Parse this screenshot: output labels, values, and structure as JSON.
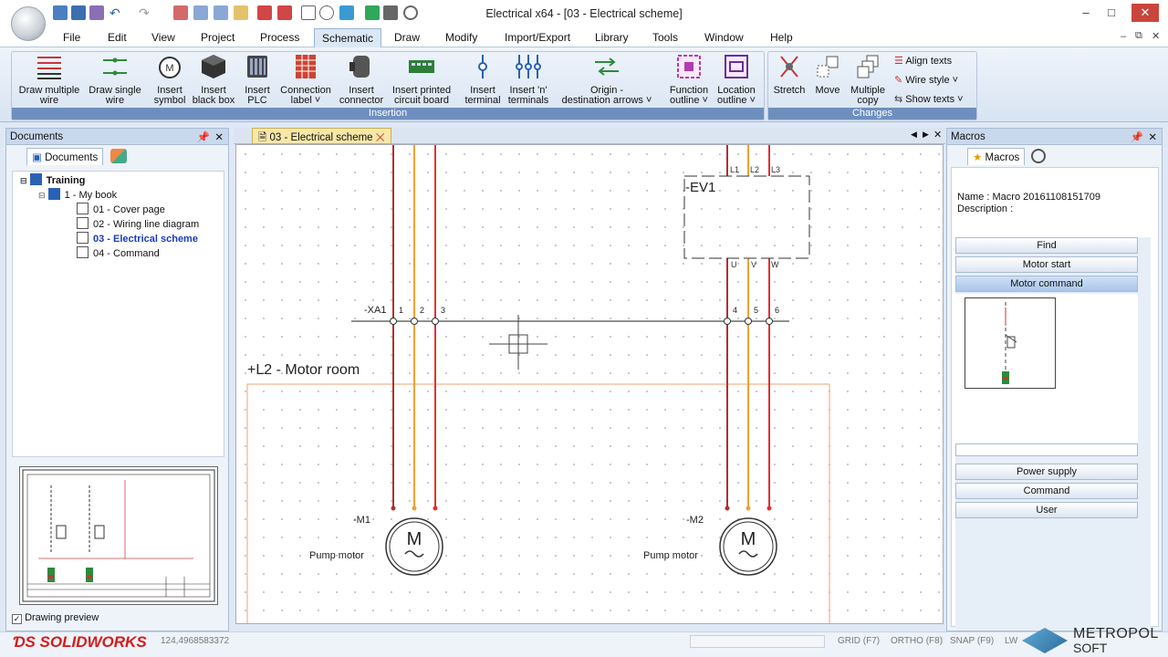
{
  "window": {
    "title": "Electrical x64 - [03 - Electrical scheme]"
  },
  "menu": [
    "File",
    "Edit",
    "View",
    "Project",
    "Process",
    "Schematic",
    "Draw",
    "Modify",
    "Import/Export",
    "Library",
    "Tools",
    "Window",
    "Help"
  ],
  "ribbon": {
    "insertion": {
      "label": "Insertion",
      "draw_multiple_wire": [
        "Draw multiple",
        "wire"
      ],
      "draw_single_wire": [
        "Draw single",
        "wire"
      ],
      "insert_symbol": [
        "Insert",
        "symbol"
      ],
      "insert_black_box": [
        "Insert",
        "black box"
      ],
      "insert_plc": [
        "Insert",
        "PLC"
      ],
      "connection_label": [
        "Connection",
        "label ˅"
      ],
      "insert_connector": [
        "Insert",
        "connector"
      ],
      "insert_pcb": [
        "Insert printed",
        "circuit board"
      ],
      "insert_terminal": [
        "Insert",
        "terminal"
      ],
      "insert_n_terminals": [
        "Insert 'n'",
        "terminals"
      ],
      "origin_destination": [
        "Origin -",
        "destination arrows ˅"
      ],
      "function_outline": [
        "Function",
        "outline ˅"
      ],
      "location_outline": [
        "Location",
        "outline ˅"
      ]
    },
    "changes": {
      "label": "Changes",
      "stretch": "Stretch",
      "move": "Move",
      "multiple_copy": [
        "Multiple",
        "copy"
      ],
      "align_texts": "Align texts",
      "wire_style": "Wire style ˅",
      "show_texts": "Show texts ˅"
    }
  },
  "documents_panel": {
    "header": "Documents",
    "tab": "Documents",
    "tree": {
      "root": "Training",
      "book": "1 - My book",
      "items": [
        "01 - Cover page",
        "02 - Wiring line diagram",
        "03 - Electrical scheme",
        "04 - Command"
      ]
    },
    "preview_label": "Drawing preview"
  },
  "doc_tab": "03 - Electrical scheme",
  "schematic": {
    "terminal_strip": "-XA1",
    "terminal_nums": [
      "1",
      "2",
      "3",
      "4",
      "5",
      "6"
    ],
    "location": "+L2 - Motor room",
    "ev1": "-EV1",
    "ev1_top": [
      "L1",
      "L2",
      "L3"
    ],
    "ev1_bottom": [
      "U",
      "V",
      "W"
    ],
    "motor1_tag": "-M1",
    "motor2_tag": "-M2",
    "motor_label": "Pump motor",
    "motor_letter": "M"
  },
  "macros_panel": {
    "header": "Macros",
    "tab": "Macros",
    "name": "Name : Macro 20161108151709",
    "description": "Description :",
    "buttons_top": [
      "Find",
      "Motor start",
      "Motor command"
    ],
    "buttons_bottom": [
      "Power supply",
      "Command",
      "User"
    ]
  },
  "status": {
    "coords": "124,4968583372",
    "grid": "GRID (F7)",
    "ortho": "ORTHO (F8)",
    "snap": "SNAP (F9)",
    "lw": "LW"
  },
  "branding": {
    "solidworks": "SOLIDWORKS",
    "metropol_1": "METROPOL",
    "metropol_2": "SOFT"
  }
}
